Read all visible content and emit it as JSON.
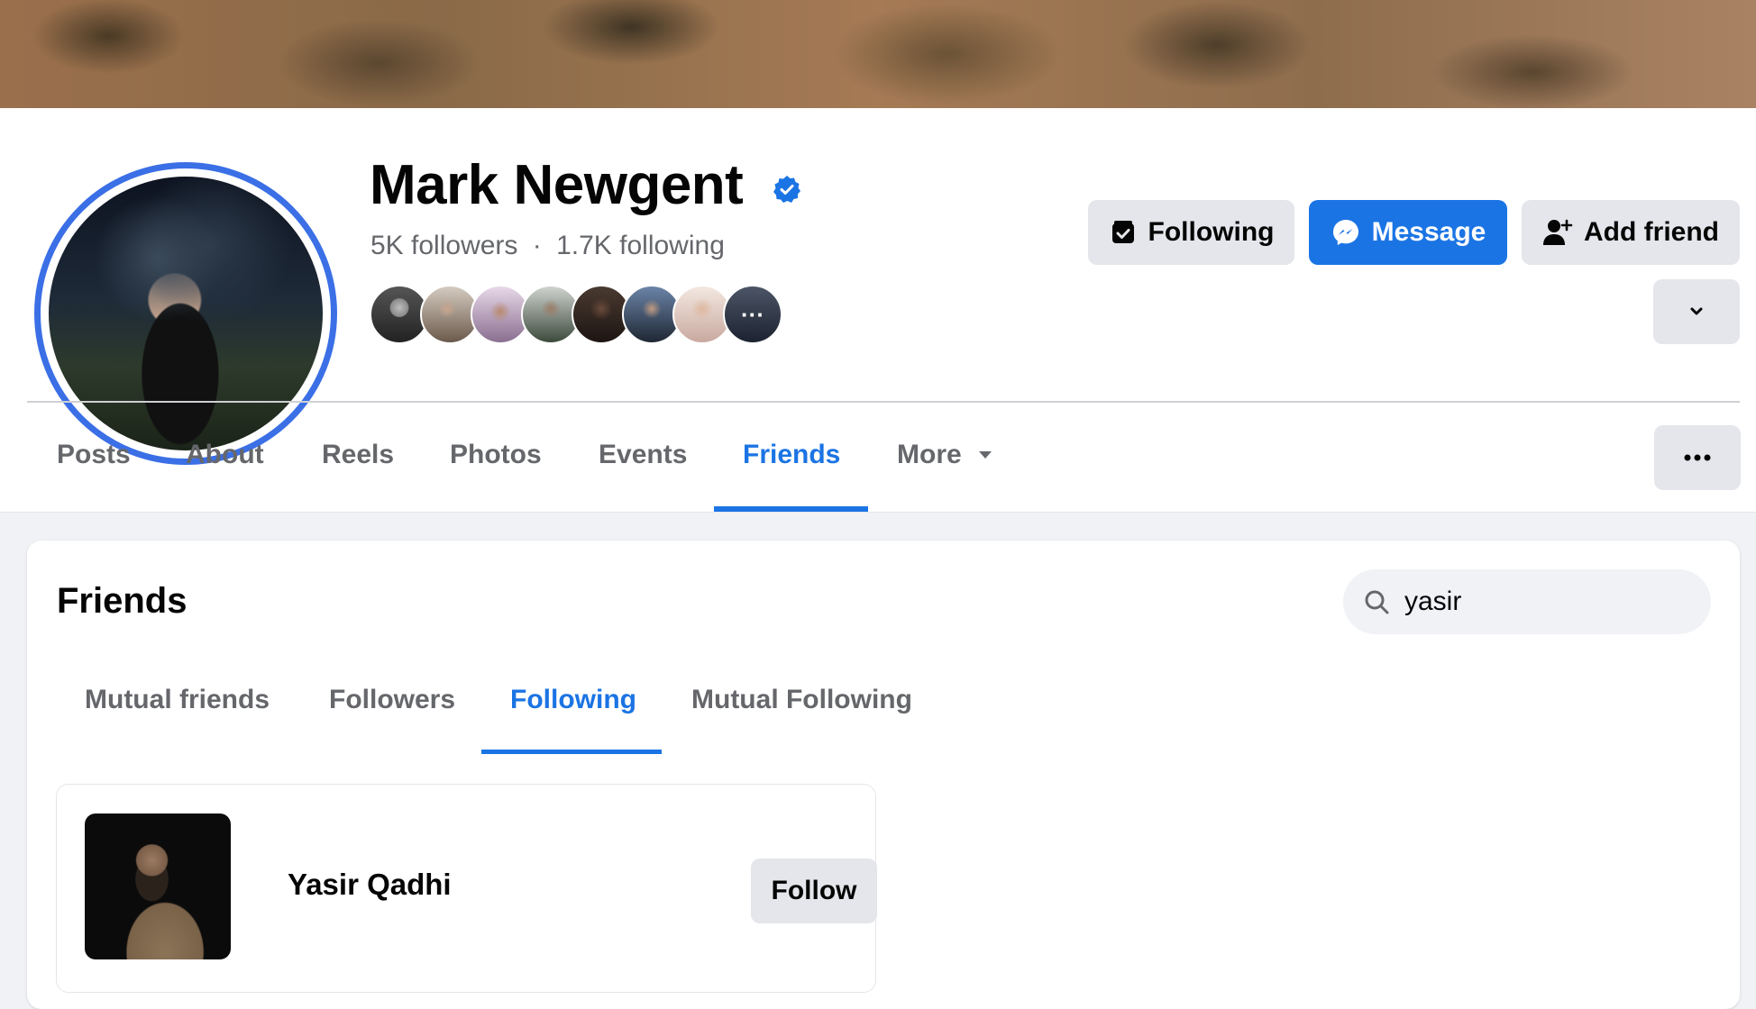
{
  "profile": {
    "name": "Mark Newgent",
    "followers": "5K followers",
    "separator": "·",
    "following": "1.7K following",
    "mutual_friends_more": "···"
  },
  "actions": {
    "following_label": "Following",
    "message_label": "Message",
    "add_friend_label": "Add friend"
  },
  "tabs": [
    {
      "label": "Posts"
    },
    {
      "label": "About"
    },
    {
      "label": "Reels"
    },
    {
      "label": "Photos"
    },
    {
      "label": "Events"
    },
    {
      "label": "Friends"
    },
    {
      "label": "More"
    }
  ],
  "active_tab": "Friends",
  "friends_section": {
    "title": "Friends",
    "search_value": "yasir",
    "subtabs": [
      {
        "label": "Mutual friends"
      },
      {
        "label": "Followers"
      },
      {
        "label": "Following"
      },
      {
        "label": "Mutual Following"
      }
    ],
    "active_subtab": "Following",
    "results": [
      {
        "name": "Yasir Qadhi",
        "action_label": "Follow"
      }
    ]
  },
  "colors": {
    "accent": "#1b74e4",
    "avatar_ring": "#3b6fe6",
    "button_grey": "#e4e6eb",
    "text_secondary": "#65676b"
  }
}
